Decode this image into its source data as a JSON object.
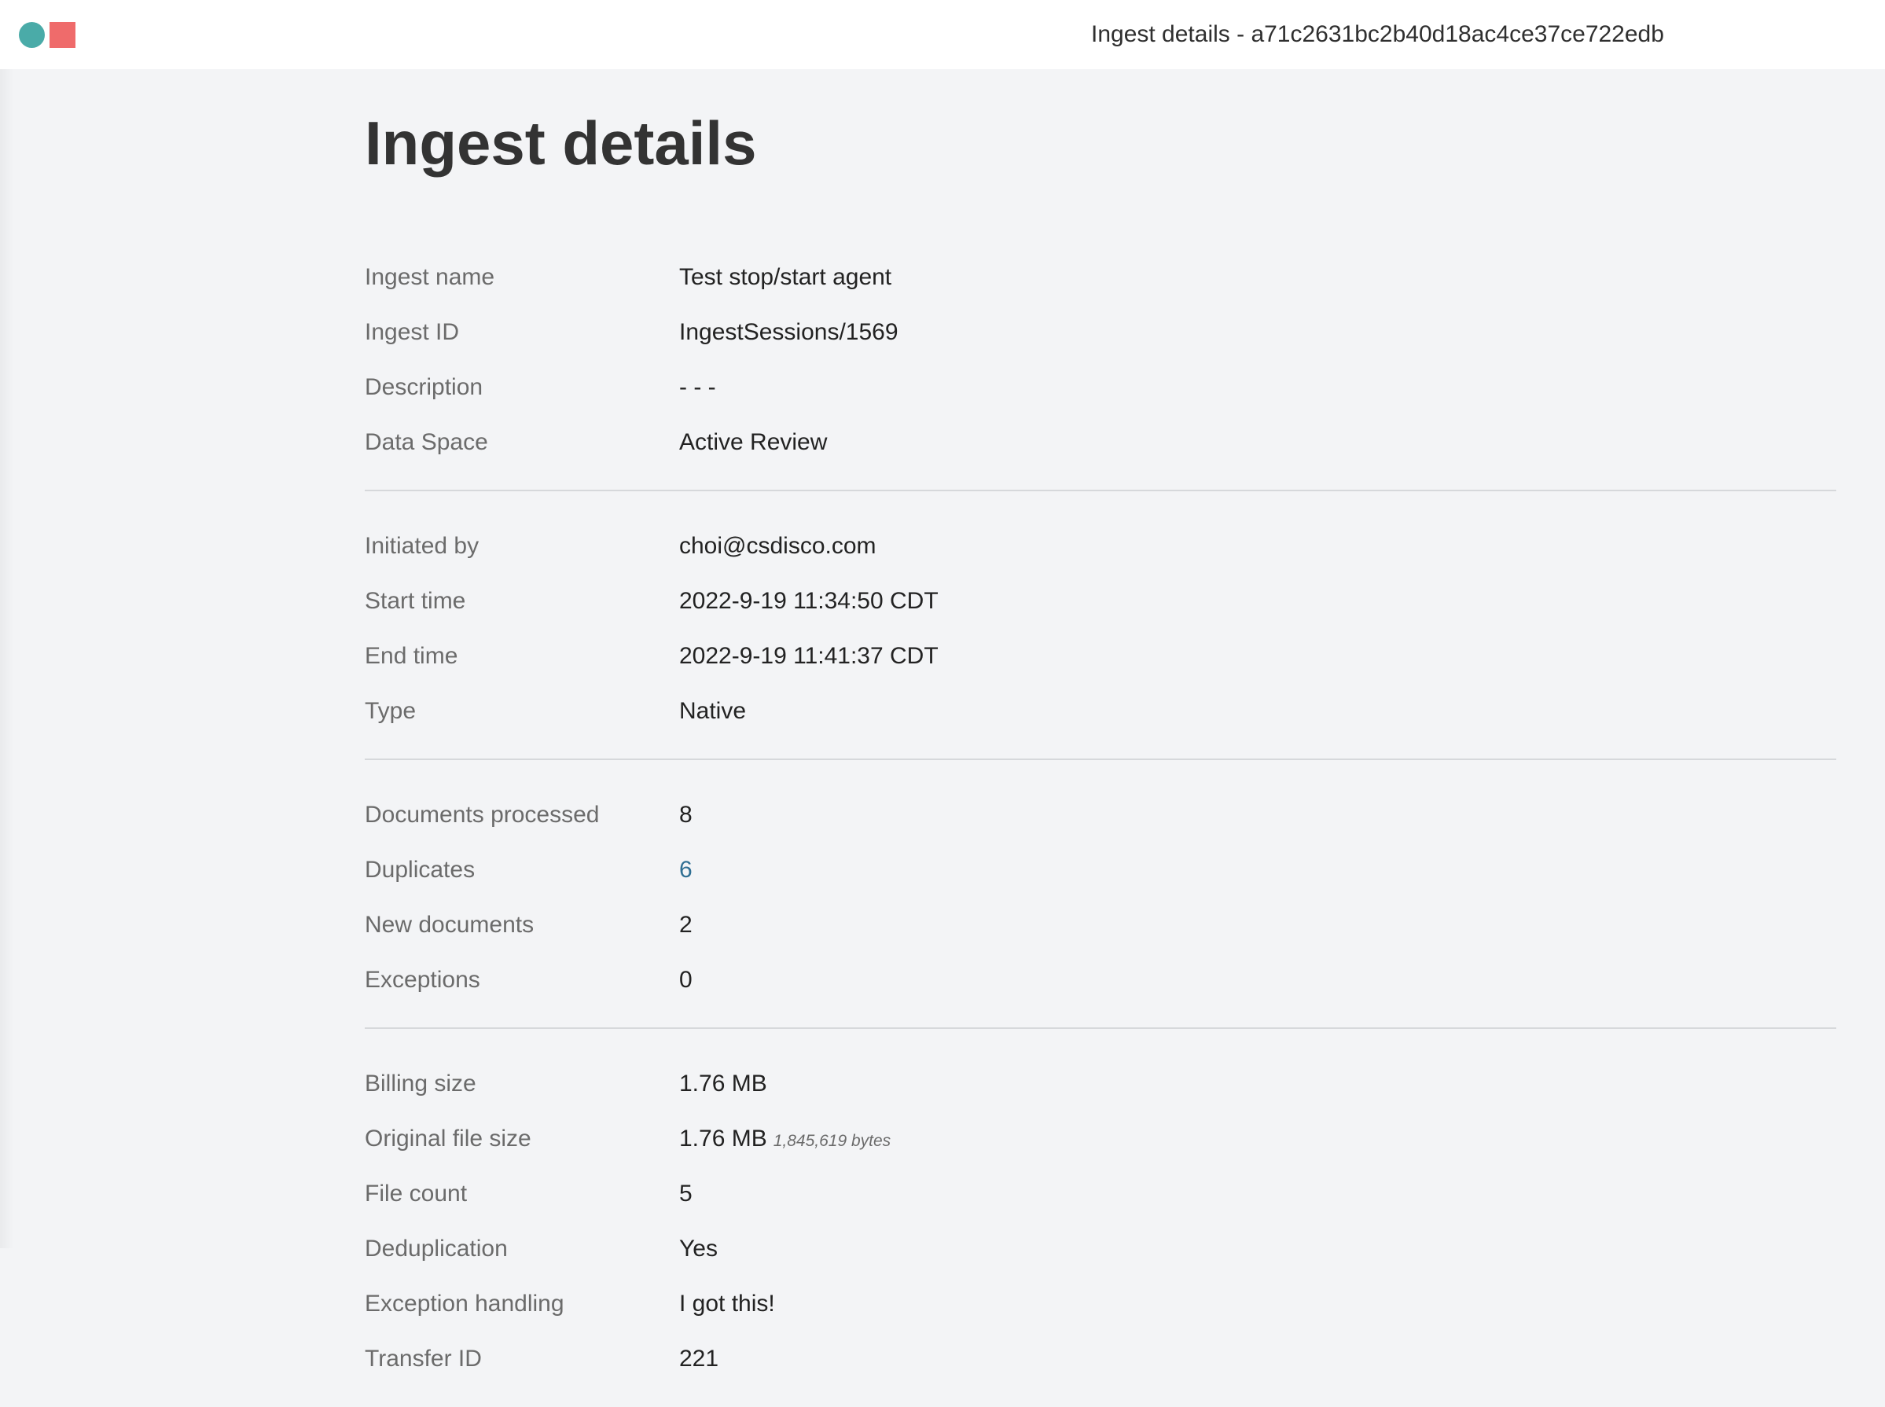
{
  "colors": {
    "logo_circle": "#4aaba8",
    "logo_square": "#ef6b6b",
    "link": "#2f6f93"
  },
  "window": {
    "title": "Ingest details - a71c2631bc2b40d18ac4ce37ce722edb",
    "logo_icon": "app-logo-icon"
  },
  "page": {
    "title": "Ingest details"
  },
  "details": {
    "section1": [
      {
        "label": "Ingest name",
        "value": "Test stop/start agent"
      },
      {
        "label": "Ingest ID",
        "value": "IngestSessions/1569"
      },
      {
        "label": "Description",
        "value": "- - -"
      },
      {
        "label": "Data Space",
        "value": "Active Review"
      }
    ],
    "section2": [
      {
        "label": "Initiated by",
        "value": "choi@csdisco.com"
      },
      {
        "label": "Start time",
        "value": "2022-9-19 11:34:50 CDT"
      },
      {
        "label": "End time",
        "value": "2022-9-19 11:41:37 CDT"
      },
      {
        "label": "Type",
        "value": "Native"
      }
    ],
    "section3": [
      {
        "label": "Documents processed",
        "value": "8"
      },
      {
        "label": "Duplicates",
        "value": "6"
      },
      {
        "label": "New documents",
        "value": "2"
      },
      {
        "label": "Exceptions",
        "value": "0"
      }
    ],
    "section4": [
      {
        "label": "Billing size",
        "value": "1.76 MB"
      },
      {
        "label": "Original file size",
        "value": "1.76 MB",
        "note": "1,845,619 bytes"
      },
      {
        "label": "File count",
        "value": "5"
      },
      {
        "label": "Deduplication",
        "value": "Yes"
      },
      {
        "label": "Exception handling",
        "value": "I got this!"
      },
      {
        "label": "Transfer ID",
        "value": "221"
      }
    ]
  }
}
